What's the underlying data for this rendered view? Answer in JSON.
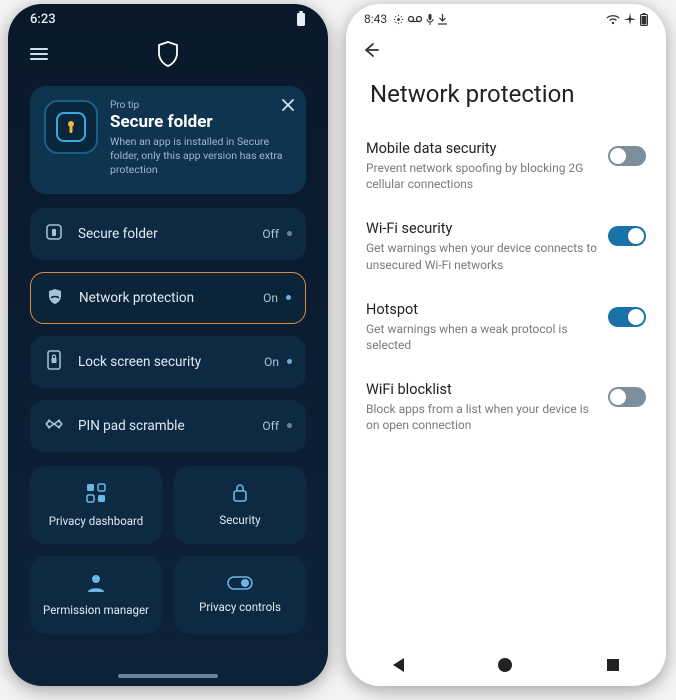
{
  "left": {
    "status_time": "6:23",
    "protip": {
      "kicker": "Pro tip",
      "title": "Secure folder",
      "desc": "When an app is installed in Secure folder, only this app version has extra protection"
    },
    "features": [
      {
        "icon": "secure-folder-icon",
        "label": "Secure folder",
        "status": "Off",
        "on": false,
        "highlight": false
      },
      {
        "icon": "network-shield-icon",
        "label": "Network protection",
        "status": "On",
        "on": true,
        "highlight": true
      },
      {
        "icon": "lock-screen-icon",
        "label": "Lock screen security",
        "status": "On",
        "on": true,
        "highlight": false
      },
      {
        "icon": "pin-scramble-icon",
        "label": "PIN pad scramble",
        "status": "Off",
        "on": false,
        "highlight": false
      }
    ],
    "tiles": [
      {
        "icon": "dashboard-icon",
        "label": "Privacy dashboard"
      },
      {
        "icon": "lock-icon",
        "label": "Security"
      },
      {
        "icon": "person-icon",
        "label": "Permission manager"
      },
      {
        "icon": "toggle-icon",
        "label": "Privacy controls"
      }
    ]
  },
  "right": {
    "status_time": "8:43",
    "page_title": "Network protection",
    "settings": [
      {
        "title": "Mobile data security",
        "desc": "Prevent network spoofing by blocking 2G cellular connections",
        "on": false
      },
      {
        "title": "Wi-Fi security",
        "desc": "Get warnings when your device connects to unsecured Wi-Fi networks",
        "on": true
      },
      {
        "title": "Hotspot",
        "desc": "Get warnings when a weak protocol is selected",
        "on": true
      },
      {
        "title": "WiFi blocklist",
        "desc": "Block apps from a list when your device is on open connection",
        "on": false
      }
    ]
  }
}
